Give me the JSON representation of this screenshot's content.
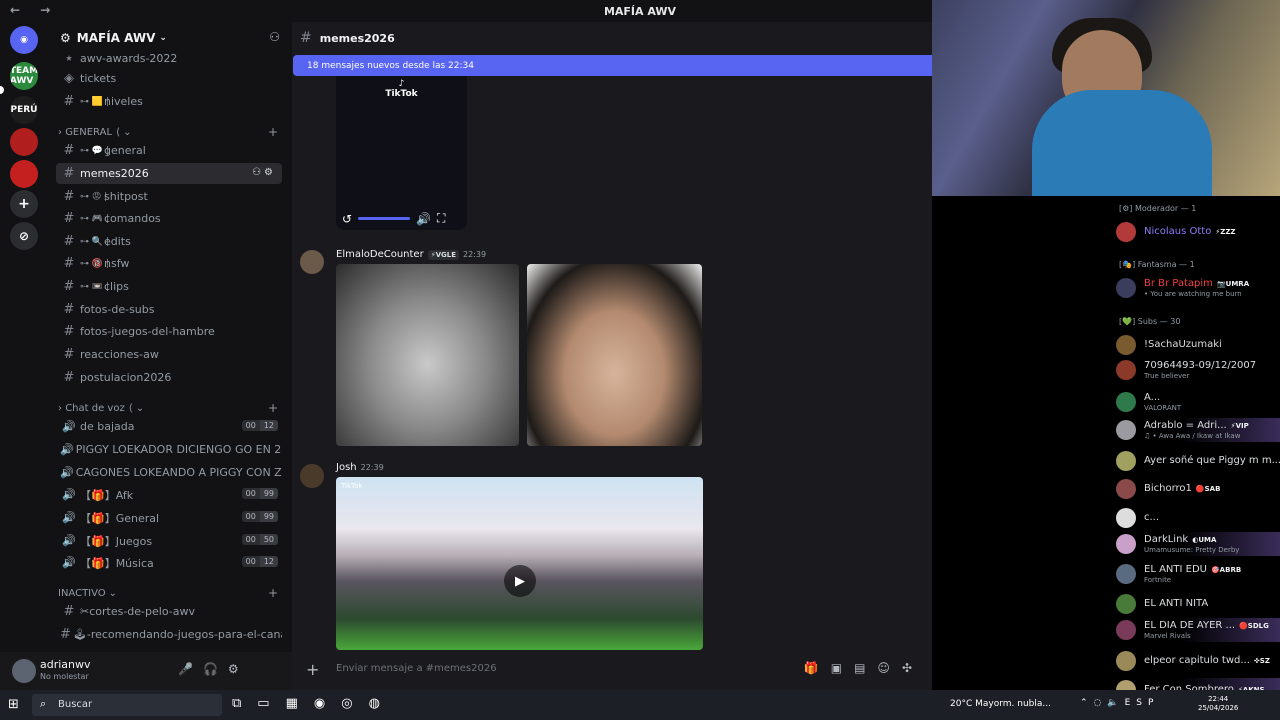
{
  "titlebar": {
    "title": "MAFÍA AWV",
    "nav": "← →"
  },
  "rail": {
    "servers": [
      "TEAM AWV",
      "PERÚ"
    ],
    "add_icon": "+",
    "discover_icon": "⊘"
  },
  "sidebar": {
    "server_name": "MAFÍA AWV",
    "channels_top": [
      {
        "name": "awv-awards-2022",
        "icon": "⭑"
      },
      {
        "name": "tickets",
        "icon": "◈"
      },
      {
        "name": "niveles",
        "emoji": "⊶ 🟨 |"
      }
    ],
    "category_general": "GENERAL",
    "channels_general": [
      {
        "name": "general",
        "emoji": "⊶ 💬 |"
      },
      {
        "name": "memes2026",
        "emoji": ""
      },
      {
        "name": "shitpost",
        "emoji": "⊶ 😡 |"
      },
      {
        "name": "comandos",
        "emoji": "⊶ 🎮 |"
      },
      {
        "name": "edits",
        "emoji": "⊶ 🔍 |"
      },
      {
        "name": "nsfw",
        "emoji": "⊶ 🔞 |"
      },
      {
        "name": "clips",
        "emoji": "⊶ 📼 |"
      },
      {
        "name": "fotos-de-subs",
        "emoji": ""
      },
      {
        "name": "fotos-juegos-del-hambre",
        "emoji": ""
      },
      {
        "name": "reacciones-aw",
        "emoji": ""
      },
      {
        "name": "postulacion2026",
        "emoji": ""
      }
    ],
    "category_voice": "Chat de voz",
    "voice_channels": [
      {
        "name": "de bajada",
        "count_a": "00",
        "count_b": "12"
      },
      {
        "name": "PIGGY LOEKADOR DICIENGO GO EN 20 ...",
        "count_a": "",
        "count_b": ""
      },
      {
        "name": "CAGONES LOKEANDO A PIGGY CON ZO...",
        "count_a": "",
        "count_b": ""
      },
      {
        "name": "【🎁】Afk",
        "count_a": "00",
        "count_b": "99"
      },
      {
        "name": "【🎁】General",
        "count_a": "00",
        "count_b": "99"
      },
      {
        "name": "【🎁】Juegos",
        "count_a": "00",
        "count_b": "50"
      },
      {
        "name": "【🎁】Música",
        "count_a": "00",
        "count_b": "12"
      }
    ],
    "category_inactive": "INACTIVO",
    "channels_inactive": [
      {
        "name": "✂cortes-de-pelo-awv"
      },
      {
        "name": "🕹-recomendando-juegos-para-el-canal"
      }
    ],
    "user": {
      "name": "adrianwv",
      "status": "No molestar"
    }
  },
  "main": {
    "channel_name": "memes2026",
    "new_messages_bar": "18 mensajes nuevos desde las 22:34",
    "tiktok_label": "TikTok",
    "messages": [
      {
        "author": "ElmaloDeCounter",
        "tag": "⚡VGLE",
        "time": "22:39"
      },
      {
        "author": "Josh",
        "tag": "",
        "time": "22:39"
      }
    ],
    "video_caption": "TikTok",
    "composer_placeholder": "Enviar mensaje a #memes2026"
  },
  "members": {
    "groups": [
      {
        "label": "[⚙] Moderador — 1"
      },
      {
        "label": "[🎭] Fantasma — 1"
      },
      {
        "label": "[💚] Subs — 30"
      }
    ],
    "list": [
      {
        "name": "Nicolaus Otto",
        "badge": "⚡ZZZ",
        "sub": "",
        "color": "#8b7cf8",
        "av": "#b33a3a"
      },
      {
        "name": "Br Br Patapim",
        "badge": "📷UMRA",
        "sub": "• You are watching me burn",
        "color": "#f23f43",
        "av": "#3b3d5c"
      },
      {
        "name": "!SachaUzumaki",
        "badge": "",
        "sub": "",
        "color": "#dbdee1",
        "av": "#7a5a2f"
      },
      {
        "name": "70964493-09/12/2007",
        "badge": "",
        "sub": "True believer",
        "color": "#dbdee1",
        "av": "#8b3a2a"
      },
      {
        "name": "A...",
        "badge": "",
        "sub": "VALORANT",
        "color": "#dbdee1",
        "av": "#2f7a4a"
      },
      {
        "name": "Adrablo = Adri...",
        "badge": "⚡VIP",
        "sub": "♫ • Awa Awa / Ikaw at Ikaw",
        "color": "#dbdee1",
        "av": "#9a9aa0"
      },
      {
        "name": "Ayer soñé que Piggy m m...",
        "badge": "",
        "sub": "",
        "color": "#dbdee1",
        "av": "#a0a060"
      },
      {
        "name": "Bichorro1",
        "badge": "🔴SAB",
        "sub": "",
        "color": "#dbdee1",
        "av": "#8a4a4a"
      },
      {
        "name": "c...",
        "badge": "",
        "sub": "",
        "color": "#dbdee1",
        "av": "#ddd"
      },
      {
        "name": "DarkLink",
        "badge": "◐UMA",
        "sub": "Umamusume: Pretty Derby",
        "color": "#dbdee1",
        "av": "#c9a0c9"
      },
      {
        "name": "EL ANTI EDU",
        "badge": "🎯ABRB",
        "sub": "Fortnite",
        "color": "#dbdee1",
        "av": "#5a6a80"
      },
      {
        "name": "EL ANTI NITA",
        "badge": "",
        "sub": "",
        "color": "#dbdee1",
        "av": "#4a7a3a"
      },
      {
        "name": "EL DIA DE AYER ...",
        "badge": "🔴SDLG",
        "sub": "Marvel Rivals",
        "color": "#dbdee1",
        "av": "#7a3a5a"
      },
      {
        "name": "elpeor capitulo twd...",
        "badge": "✜SZ",
        "sub": "",
        "color": "#dbdee1",
        "av": "#9a8a5a"
      },
      {
        "name": "Fer Con Sombrero",
        "badge": "⚡AKNS",
        "sub": "",
        "color": "#dbdee1",
        "av": "#b0a070"
      }
    ]
  },
  "taskbar": {
    "search_label": "Buscar",
    "weather": "20°C  Mayorm. nubla...",
    "lang": "ESP",
    "time": "22:44",
    "date": "25/04/2026"
  },
  "colors": {
    "accent": "#5865f2",
    "bg": "#121214",
    "chat_bg": "#1a1a1e"
  }
}
